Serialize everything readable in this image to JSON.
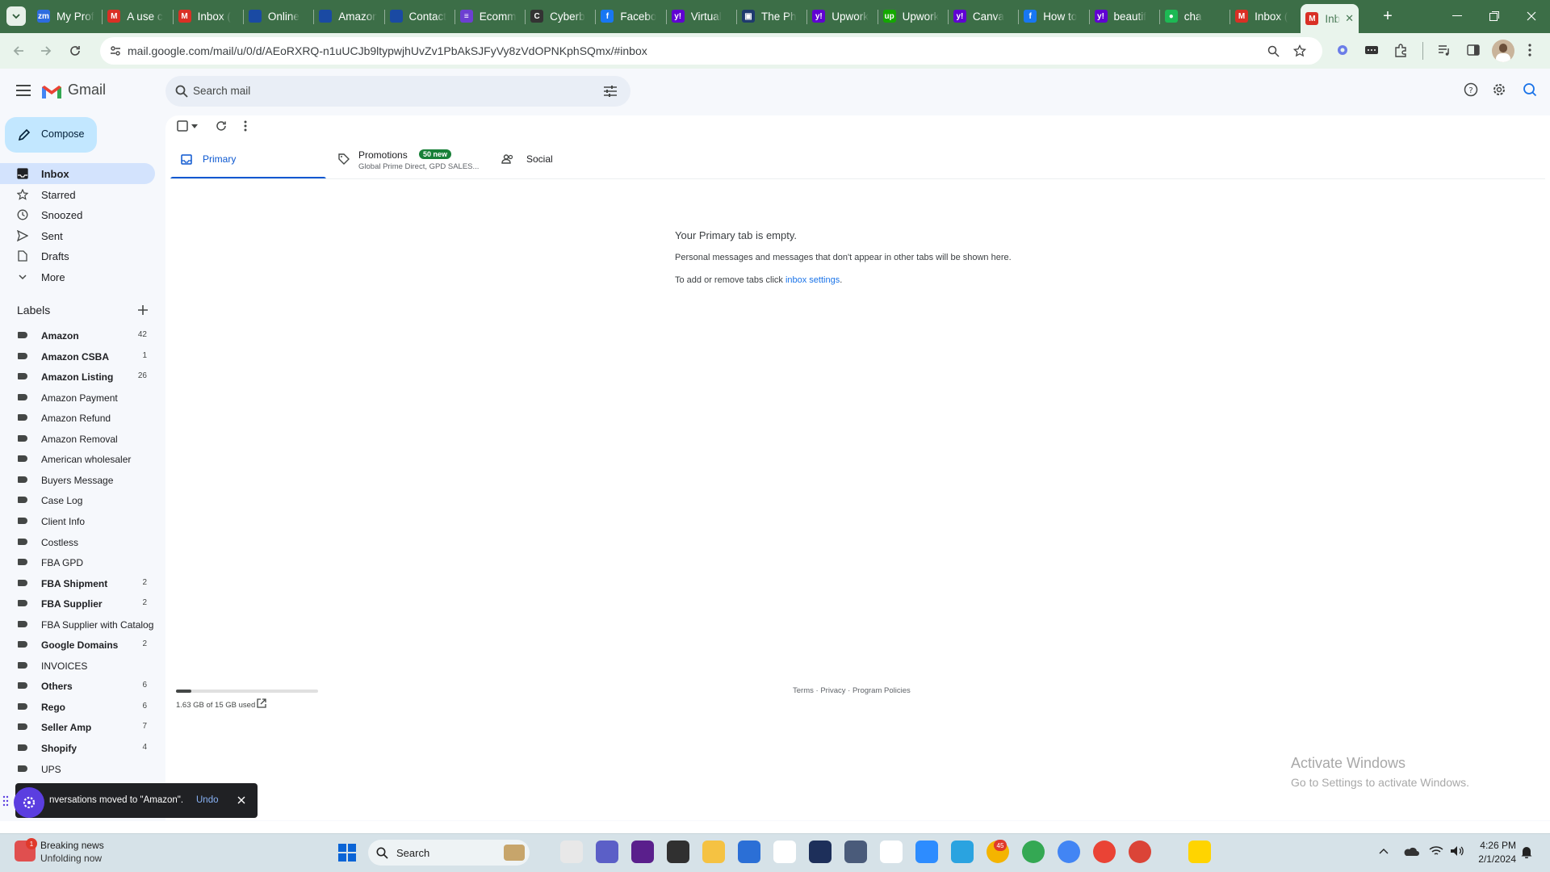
{
  "browser": {
    "tabs": [
      {
        "title": "My Prof",
        "fav": "zm",
        "color": "#2d6cdf"
      },
      {
        "title": "A use c",
        "fav": "M",
        "color": "#d93025"
      },
      {
        "title": "Inbox (",
        "fav": "M",
        "color": "#d93025"
      },
      {
        "title": "Online",
        "fav": "",
        "color": "#1a4aa3"
      },
      {
        "title": "Amazon",
        "fav": "",
        "color": "#1a4aa3"
      },
      {
        "title": "Contact",
        "fav": "",
        "color": "#1a4aa3"
      },
      {
        "title": "Ecomm",
        "fav": "≡",
        "color": "#6c3fd1"
      },
      {
        "title": "Cyberb",
        "fav": "C",
        "color": "#333"
      },
      {
        "title": "Facebo",
        "fav": "f",
        "color": "#1877f2"
      },
      {
        "title": "Virtual",
        "fav": "y!",
        "color": "#6001d2"
      },
      {
        "title": "The Ph",
        "fav": "▣",
        "color": "#1f3a6e"
      },
      {
        "title": "Upwork",
        "fav": "y!",
        "color": "#6001d2"
      },
      {
        "title": "Upwork",
        "fav": "up",
        "color": "#14a800"
      },
      {
        "title": "Canva",
        "fav": "y!",
        "color": "#6001d2"
      },
      {
        "title": "How to",
        "fav": "f",
        "color": "#1877f2"
      },
      {
        "title": "beautif",
        "fav": "y!",
        "color": "#6001d2"
      },
      {
        "title": "cha",
        "fav": "●",
        "color": "#1db954"
      },
      {
        "title": "Inbox (",
        "fav": "M",
        "color": "#d93025"
      },
      {
        "title": "Inb",
        "fav": "M",
        "color": "#d93025",
        "active": true
      }
    ],
    "new_tab": "+",
    "url": "mail.google.com/mail/u/0/d/AEoRXRQ-n1uUCJb9ltypwjhUvZv1PbAkSJFyVy8zVdOPNKphSQmx/#inbox"
  },
  "gmail": {
    "logo_text": "Gmail",
    "search_placeholder": "Search mail",
    "compose": "Compose",
    "nav": [
      {
        "label": "Inbox",
        "icon": "inbox-icon",
        "active": true
      },
      {
        "label": "Starred",
        "icon": "star-icon"
      },
      {
        "label": "Snoozed",
        "icon": "clock-icon"
      },
      {
        "label": "Sent",
        "icon": "send-icon"
      },
      {
        "label": "Drafts",
        "icon": "draft-icon"
      },
      {
        "label": "More",
        "icon": "chevron-down-icon"
      }
    ],
    "labels_heading": "Labels",
    "labels": [
      {
        "name": "Amazon",
        "count": "42",
        "bold": true
      },
      {
        "name": "Amazon CSBA",
        "count": "1",
        "bold": true
      },
      {
        "name": "Amazon Listing",
        "count": "26",
        "bold": true
      },
      {
        "name": "Amazon Payment",
        "count": ""
      },
      {
        "name": "Amazon Refund",
        "count": ""
      },
      {
        "name": "Amazon Removal",
        "count": ""
      },
      {
        "name": "American wholesaler",
        "count": ""
      },
      {
        "name": "Buyers Message",
        "count": ""
      },
      {
        "name": "Case Log",
        "count": ""
      },
      {
        "name": "Client Info",
        "count": ""
      },
      {
        "name": "Costless",
        "count": ""
      },
      {
        "name": "FBA GPD",
        "count": ""
      },
      {
        "name": "FBA Shipment",
        "count": "2",
        "bold": true
      },
      {
        "name": "FBA Supplier",
        "count": "2",
        "bold": true
      },
      {
        "name": "FBA Supplier with Catalog",
        "count": ""
      },
      {
        "name": "Google Domains",
        "count": "2",
        "bold": true
      },
      {
        "name": "INVOICES",
        "count": ""
      },
      {
        "name": "Others",
        "count": "6",
        "bold": true
      },
      {
        "name": "Rego",
        "count": "6",
        "bold": true
      },
      {
        "name": "Seller Amp",
        "count": "7",
        "bold": true
      },
      {
        "name": "Shopify",
        "count": "4",
        "bold": true
      },
      {
        "name": "UPS",
        "count": ""
      }
    ],
    "tabs": {
      "primary": "Primary",
      "promotions": "Promotions",
      "promotions_badge": "50 new",
      "promotions_sub": "Global Prime Direct, GPD SALES...",
      "social": "Social"
    },
    "empty": {
      "title": "Your Primary tab is empty.",
      "line1": "Personal messages and messages that don't appear in other tabs will be shown here.",
      "line2_prefix": "To add or remove tabs click ",
      "line2_link": "inbox settings",
      "line2_suffix": "."
    },
    "storage": {
      "text": "1.63 GB of 15 GB used",
      "fraction": 0.109
    },
    "footer": {
      "terms": "Terms",
      "sep": "·",
      "privacy": "Privacy",
      "policies": "Program Policies"
    },
    "toast": {
      "text": "nversations moved to \"Amazon\".",
      "undo": "Undo"
    },
    "watermark": {
      "title": "Activate Windows",
      "sub": "Go to Settings to activate Windows."
    }
  },
  "taskbar": {
    "news_title": "Breaking news",
    "news_sub": "Unfolding now",
    "news_badge": "1",
    "search": "Search",
    "time": "4:26 PM",
    "date": "2/1/2024",
    "telegram_badge": "45"
  }
}
